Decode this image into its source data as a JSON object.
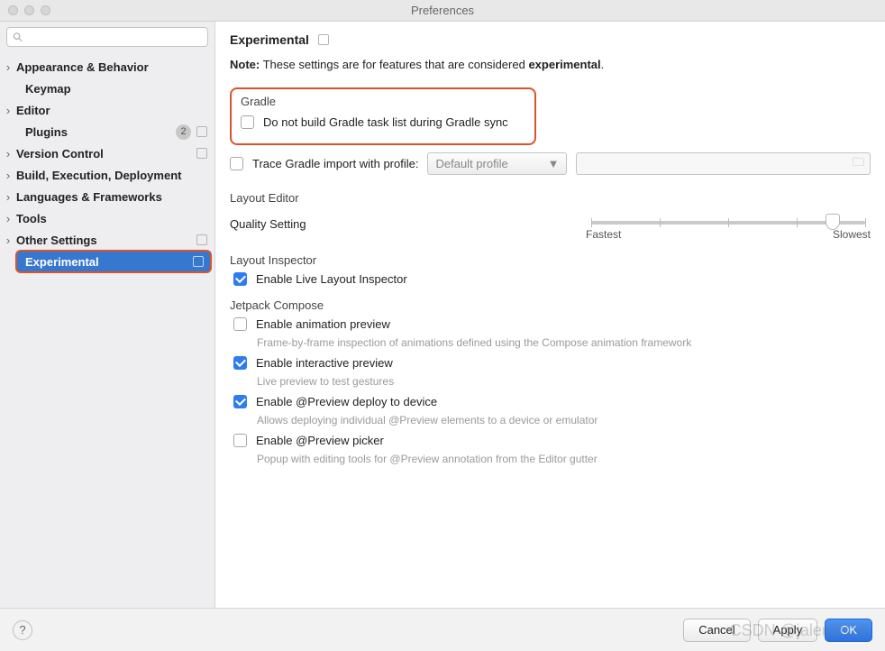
{
  "window": {
    "title": "Preferences"
  },
  "sidebar": {
    "search_placeholder": "",
    "items": [
      {
        "label": "Appearance & Behavior",
        "arrow": true,
        "bold": true
      },
      {
        "label": "Keymap",
        "arrow": false,
        "bold": true,
        "indent": true
      },
      {
        "label": "Editor",
        "arrow": true,
        "bold": true
      },
      {
        "label": "Plugins",
        "arrow": false,
        "bold": true,
        "indent": true,
        "badge": "2",
        "boxico": true
      },
      {
        "label": "Version Control",
        "arrow": true,
        "bold": true,
        "boxico": true
      },
      {
        "label": "Build, Execution, Deployment",
        "arrow": true,
        "bold": true
      },
      {
        "label": "Languages & Frameworks",
        "arrow": true,
        "bold": true
      },
      {
        "label": "Tools",
        "arrow": true,
        "bold": true
      },
      {
        "label": "Other Settings",
        "arrow": true,
        "bold": true,
        "boxico": true
      },
      {
        "label": "Experimental",
        "arrow": false,
        "indent": true,
        "selected": true,
        "boxico": true,
        "highlight": true
      }
    ]
  },
  "page": {
    "title": "Experimental",
    "note_prefix": "Note:",
    "note_text": " These settings are for features that are considered ",
    "note_emph": "experimental",
    "note_suffix": "."
  },
  "gradle": {
    "legend": "Gradle",
    "chk1": "Do not build Gradle task list during Gradle sync",
    "chk2": "Trace Gradle import with profile:",
    "profile_placeholder": "Default profile"
  },
  "layout_editor": {
    "legend": "Layout Editor",
    "quality_label": "Quality Setting",
    "fastest": "Fastest",
    "slowest": "Slowest"
  },
  "layout_inspector": {
    "legend": "Layout Inspector",
    "chk1": "Enable Live Layout Inspector"
  },
  "jetpack": {
    "legend": "Jetpack Compose",
    "c1": "Enable animation preview",
    "h1": "Frame-by-frame inspection of animations defined using the Compose animation framework",
    "c2": "Enable interactive preview",
    "h2": "Live preview to test gestures",
    "c3": "Enable @Preview deploy to device",
    "h3": "Allows deploying individual @Preview elements to a device or emulator",
    "c4": "Enable @Preview picker",
    "h4": "Popup with editing tools for @Preview annotation from the Editor gutter"
  },
  "footer": {
    "cancel": "Cancel",
    "apply": "Apply",
    "ok": "OK"
  },
  "watermark": "CSDN @jalen2024"
}
